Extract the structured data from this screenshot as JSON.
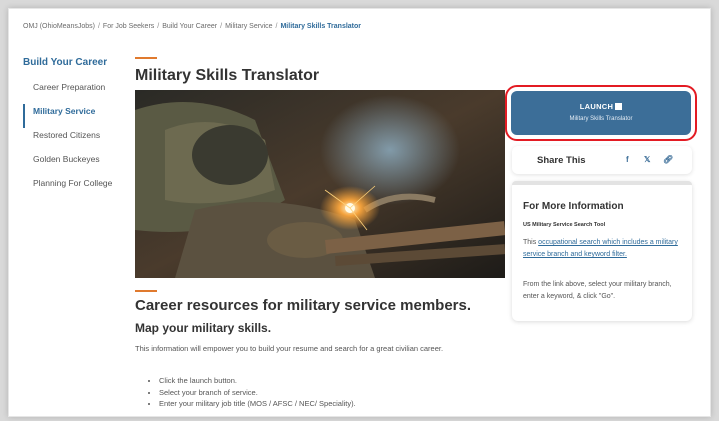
{
  "breadcrumb": [
    "OMJ (OhioMeansJobs)",
    "For Job Seekers",
    "Build Your Career",
    "Military Service",
    "Military Skills Translator"
  ],
  "sidebar": {
    "heading": "Build Your Career",
    "items": [
      "Career Preparation",
      "Military Service",
      "Restored Citizens",
      "Golden Buckeyes",
      "Planning For College"
    ],
    "active": "Military Service"
  },
  "main": {
    "title": "Military Skills Translator",
    "hero_image": "welder-at-work-photo",
    "heading2": "Career resources for military service members.",
    "heading3": "Map your military skills.",
    "paragraph": "This information will empower you to build your resume and search for a great civilian career.",
    "bullets": [
      "Click the launch button.",
      "Select your branch of service.",
      "Enter your military job title (MOS / AFSC / NEC/ Speciality)."
    ]
  },
  "launch": {
    "label": "LAUNCH",
    "icon": "external-link-icon",
    "sublabel": "Military Skills Translator",
    "highlight_color": "#e31b23"
  },
  "share": {
    "label": "Share This",
    "icons": [
      "facebook-icon",
      "twitter-icon",
      "link-icon"
    ]
  },
  "more_info": {
    "heading": "For More Information",
    "subheading": "US Military Service Search Tool",
    "text_before": "This ",
    "link_text": "occupational search which includes a military service branch and keyword filter.",
    "text2": "From the link above, select your military branch, enter a keyword, & click \"Go\"."
  },
  "colors": {
    "brand_blue": "#3c6e98",
    "accent_orange": "#e07a2e"
  }
}
